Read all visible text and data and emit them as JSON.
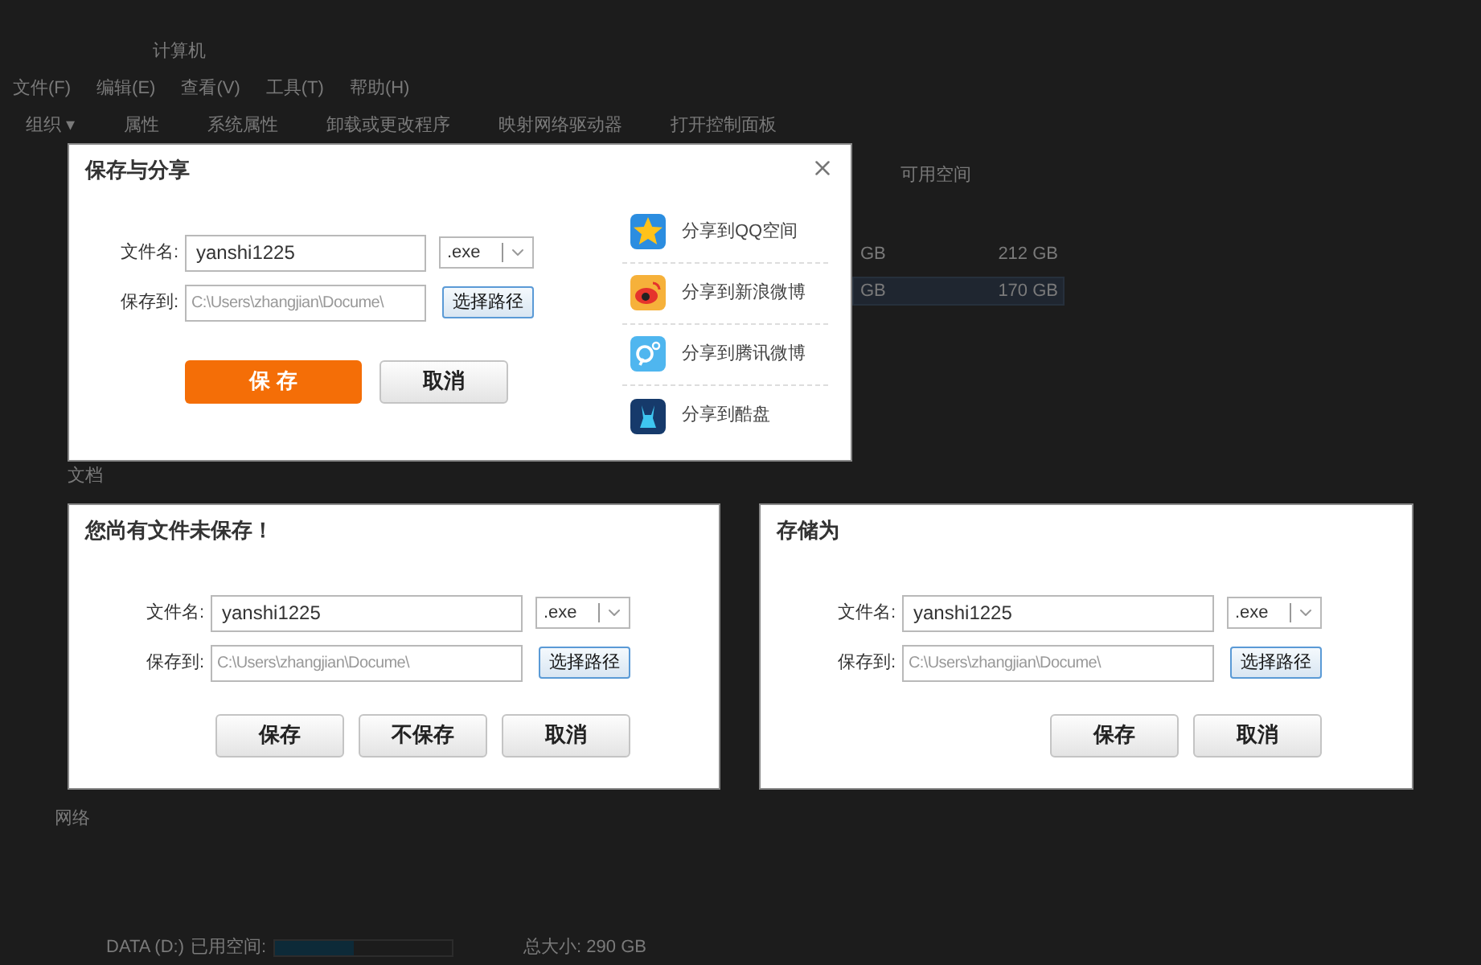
{
  "explorer": {
    "breadcrumb": "计算机",
    "menu": [
      "文件(F)",
      "编辑(E)",
      "查看(V)",
      "工具(T)",
      "帮助(H)"
    ],
    "toolbar": [
      "组织 ▾",
      "属性",
      "系统属性",
      "卸载或更改程序",
      "映射网络驱动器",
      "打开控制面板"
    ],
    "column_header": "可用空间",
    "rows": [
      {
        "size": "GB",
        "free": "212 GB",
        "selected": false
      },
      {
        "size": "GB",
        "free": "170 GB",
        "selected": true
      }
    ],
    "sidebar": [
      "文档"
    ],
    "network": "网络",
    "drive": {
      "name": "DATA (D:)",
      "used_label": "已用空间:",
      "level": 0.45,
      "total": "总大小: 290 GB"
    }
  },
  "dialogs": [
    {
      "kind": "share",
      "title": "保存与分享",
      "closable": true,
      "file_label": "文件名:",
      "file_value": "yanshi1225",
      "ext": ".exe",
      "path_label": "保存到:",
      "path_placeholder": "C:\\Users\\zhangjian\\Docume\\",
      "browse": "选择路径",
      "buttons": [
        {
          "label": "保 存",
          "primary": true
        },
        {
          "label": "取消",
          "primary": false
        }
      ],
      "share": [
        {
          "kind": "qzone",
          "label": "分享到QQ空间"
        },
        {
          "kind": "weibo",
          "label": "分享到新浪微博"
        },
        {
          "kind": "tencent",
          "label": "分享到腾讯微博"
        },
        {
          "kind": "kupan",
          "label": "分享到酷盘"
        }
      ]
    },
    {
      "kind": "plain",
      "title": "您尚有文件未保存！",
      "closable": false,
      "file_label": "文件名:",
      "file_value": "yanshi1225",
      "ext": ".exe",
      "path_label": "保存到:",
      "path_placeholder": "C:\\Users\\zhangjian\\Docume\\",
      "browse": "选择路径",
      "buttons": [
        {
          "label": "保存",
          "primary": false
        },
        {
          "label": "不保存",
          "primary": false
        },
        {
          "label": "取消",
          "primary": false
        }
      ]
    },
    {
      "kind": "plain",
      "title": "存储为",
      "closable": false,
      "file_label": "文件名:",
      "file_value": "yanshi1225",
      "ext": ".exe",
      "path_label": "保存到:",
      "path_placeholder": "C:\\Users\\zhangjian\\Docume\\",
      "browse": "选择路径",
      "buttons": [
        {
          "label": "保存",
          "primary": false
        },
        {
          "label": "取消",
          "primary": false
        }
      ]
    }
  ]
}
